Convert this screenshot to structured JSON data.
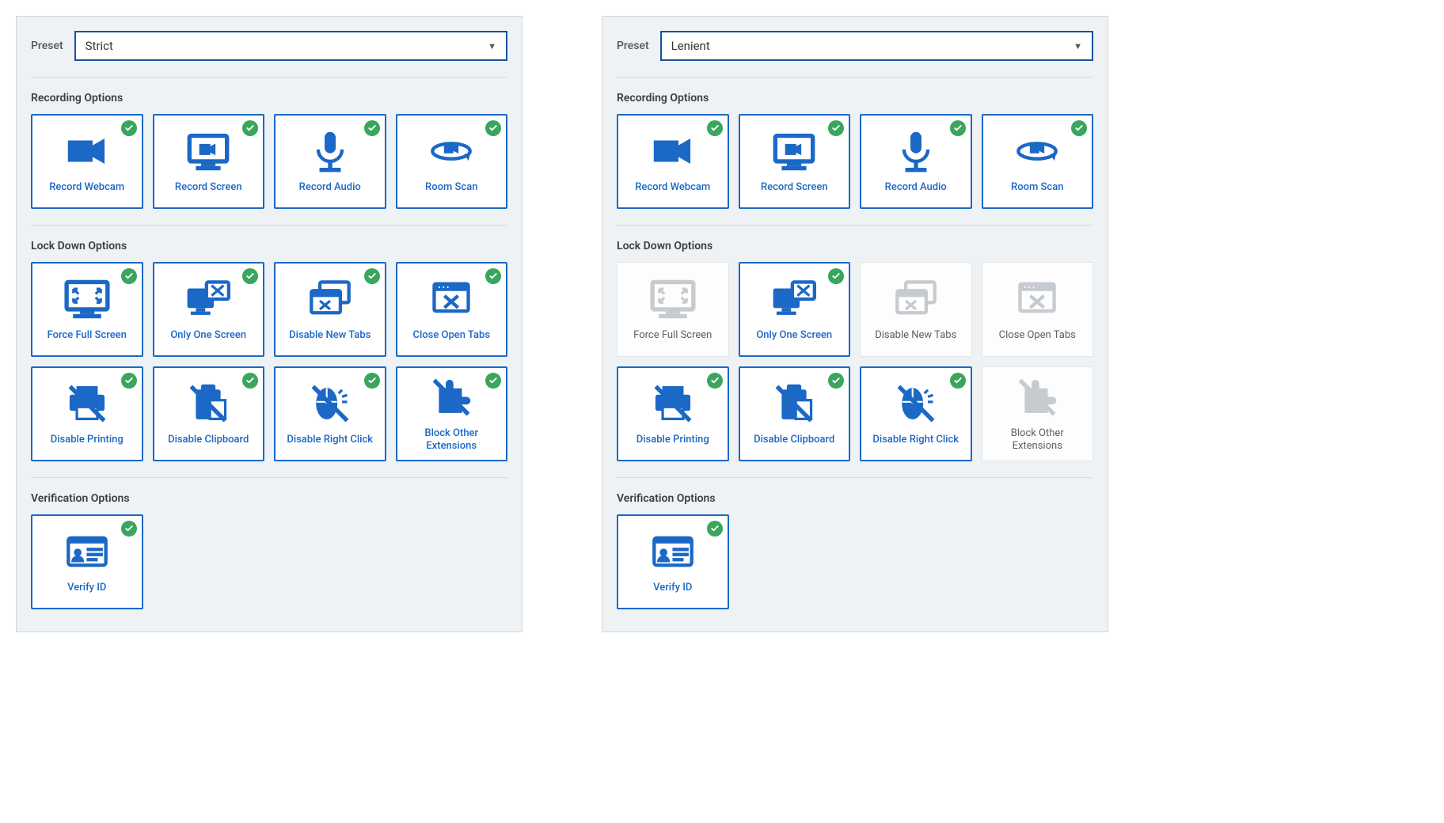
{
  "panels": [
    {
      "preset_label": "Preset",
      "preset_value": "Strict",
      "sections": [
        {
          "title": "Recording Options",
          "key": "recording",
          "options": [
            {
              "label": "Record Webcam",
              "icon": "camera",
              "enabled": true
            },
            {
              "label": "Record Screen",
              "icon": "monitor-cam",
              "enabled": true
            },
            {
              "label": "Record Audio",
              "icon": "mic",
              "enabled": true
            },
            {
              "label": "Room Scan",
              "icon": "room-scan",
              "enabled": true
            }
          ]
        },
        {
          "title": "Lock Down Options",
          "key": "lockdown",
          "options": [
            {
              "label": "Force Full Screen",
              "icon": "fullscreen",
              "enabled": true
            },
            {
              "label": "Only One Screen",
              "icon": "one-screen",
              "enabled": true
            },
            {
              "label": "Disable New Tabs",
              "icon": "no-new-tabs",
              "enabled": true
            },
            {
              "label": "Close Open Tabs",
              "icon": "close-tabs",
              "enabled": true
            },
            {
              "label": "Disable Printing",
              "icon": "no-print",
              "enabled": true
            },
            {
              "label": "Disable Clipboard",
              "icon": "no-clipboard",
              "enabled": true
            },
            {
              "label": "Disable Right Click",
              "icon": "no-right-click",
              "enabled": true
            },
            {
              "label": "Block Other Extensions",
              "icon": "no-extensions",
              "enabled": true
            }
          ]
        },
        {
          "title": "Verification Options",
          "key": "verification",
          "options": [
            {
              "label": "Verify ID",
              "icon": "id-card",
              "enabled": true
            }
          ]
        }
      ]
    },
    {
      "preset_label": "Preset",
      "preset_value": "Lenient",
      "sections": [
        {
          "title": "Recording Options",
          "key": "recording",
          "options": [
            {
              "label": "Record Webcam",
              "icon": "camera",
              "enabled": true
            },
            {
              "label": "Record Screen",
              "icon": "monitor-cam",
              "enabled": true
            },
            {
              "label": "Record Audio",
              "icon": "mic",
              "enabled": true
            },
            {
              "label": "Room Scan",
              "icon": "room-scan",
              "enabled": true
            }
          ]
        },
        {
          "title": "Lock Down Options",
          "key": "lockdown",
          "options": [
            {
              "label": "Force Full Screen",
              "icon": "fullscreen",
              "enabled": false
            },
            {
              "label": "Only One Screen",
              "icon": "one-screen",
              "enabled": true
            },
            {
              "label": "Disable New Tabs",
              "icon": "no-new-tabs",
              "enabled": false
            },
            {
              "label": "Close Open Tabs",
              "icon": "close-tabs",
              "enabled": false
            },
            {
              "label": "Disable Printing",
              "icon": "no-print",
              "enabled": true
            },
            {
              "label": "Disable Clipboard",
              "icon": "no-clipboard",
              "enabled": true
            },
            {
              "label": "Disable Right Click",
              "icon": "no-right-click",
              "enabled": true
            },
            {
              "label": "Block Other Extensions",
              "icon": "no-extensions",
              "enabled": false
            }
          ]
        },
        {
          "title": "Verification Options",
          "key": "verification",
          "options": [
            {
              "label": "Verify ID",
              "icon": "id-card",
              "enabled": true
            }
          ]
        }
      ]
    }
  ]
}
